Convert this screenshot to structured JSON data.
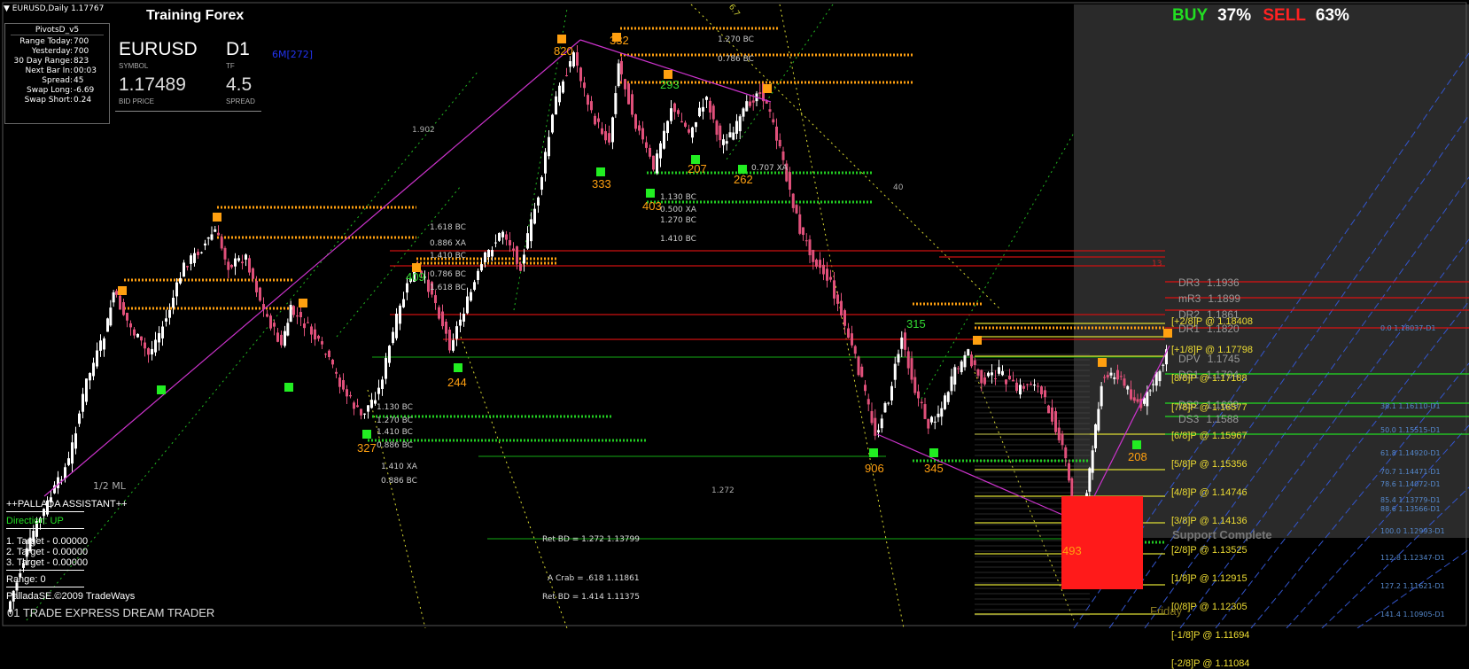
{
  "window": {
    "title": "EURUSD,Daily",
    "price": "1.17767",
    "menu_icon": "triangle-down"
  },
  "header": {
    "training_label": "Training Forex",
    "sixm_label": "6M[272]"
  },
  "pivots": {
    "title": "PivotsD_v5",
    "rows": [
      {
        "label": "Range  Today:",
        "value": "700"
      },
      {
        "label": "Yesterday:",
        "value": "700"
      },
      {
        "label": "30 Day Range:",
        "value": "823"
      },
      {
        "label": "Next Bar In:",
        "value": "00:03"
      },
      {
        "label": "Spread:",
        "value": "45"
      },
      {
        "label": "Swap  Long:",
        "value": "-6.69"
      },
      {
        "label": "Swap  Short:",
        "value": "0.24"
      }
    ]
  },
  "symbol_box": {
    "symbol": "EURUSD",
    "symbol_caption": "SYMBOL",
    "tf": "D1",
    "tf_caption": "TF",
    "bid": "1.17489",
    "bid_caption": "BID PRICE",
    "spread": "4.5",
    "spread_caption": "SPREAD"
  },
  "sentiment": {
    "buy_label": "BUY",
    "buy_pct": "37%",
    "sell_label": "SELL",
    "sell_pct": "63%",
    "buy_color": "#22dd22",
    "sell_color": "#ff2222"
  },
  "assistant": {
    "title": "++PALLADA ASSISTANT++",
    "direction": "Direction: UP",
    "targets": [
      "1. Target - 0.00000",
      "2. Target - 0.00000",
      "3. Target - 0.00000"
    ],
    "range": "Range: 0",
    "copyright": "PalladaSE.©2009 TradeWays",
    "footer": "01 TRADE EXPRESS DREAM TRADER"
  },
  "chart_labels": {
    "half_ml": "1/2 ML",
    "fib_1902": "1.902",
    "fib_1272": "1.272",
    "fib_40": "40",
    "fib_67": "6.7",
    "ret_bd_1": "Ret BD = 1.272  1.13799",
    "a_crab": "A Crab = .618  1.11861",
    "ret_bd_2": "Ret BD = 1.414  1.11375",
    "support_complete": "Support Complete",
    "friday": "Friday",
    "fib_13": "13"
  },
  "swing_labels": [
    "820",
    "332",
    "333",
    "403",
    "207",
    "293",
    "262",
    "409",
    "244",
    "327",
    "906",
    "345",
    "315",
    "493",
    "208"
  ],
  "bc_labels": [
    "1.618 BC",
    "0.886 XA",
    "1.410 BC",
    "0.786 BC",
    "1.130 BC",
    "1.270 BC",
    "1.410 BC",
    "0.886 BC",
    "1.130 BC",
    "0.500 XA",
    "1.270 BC",
    "1.410 BC",
    "1.410 XA",
    "0.886 BC",
    "1.618 BC",
    "1.270 BC",
    "0.786 BC",
    "0.707 XA"
  ],
  "pivot_levels": [
    {
      "name": "DR3",
      "value": "1.1936"
    },
    {
      "name": "mR3",
      "value": "1.1899"
    },
    {
      "name": "DR2",
      "value": "1.1861"
    },
    {
      "name": "DR1",
      "value": "1.1820"
    },
    {
      "name": "DPV",
      "value": "1.1745"
    },
    {
      "name": "DS1",
      "value": "1.1704"
    },
    {
      "name": "DS2",
      "value": "1.1629"
    },
    {
      "name": "DS3",
      "value": "1.1588"
    }
  ],
  "murrey_levels": [
    "[+2/8]P @ 1.18408",
    "[+1/8]P @ 1.17798",
    "[8/8]P @ 1.17188",
    "[7/8]P @ 1.16577",
    "[6/8]P @ 1.15967",
    "[5/8]P @ 1.15356",
    "[4/8]P @ 1.14746",
    "[3/8]P @ 1.14136",
    "[2/8]P @ 1.13525",
    "[1/8]P @ 1.12915",
    "[0/8]P @ 1.12305",
    "[-1/8]P @ 1.11694",
    "[-2/8]P @ 1.11084"
  ],
  "fib_right": [
    "0.0  1.18037-D1",
    "38.1  1.16110-D1",
    "50.0  1.15515-D1",
    "61.8  1.14920-D1",
    "70.7  1.14471-D1",
    "78.6  1.14072-D1",
    "85.4  1.13779-D1",
    "88.6  1.13566-D1",
    "100.0  1.12993-D1",
    "112.8  1.12347-D1",
    "127.2  1.11621-D1",
    "141.4  1.10905-D1"
  ],
  "colors": {
    "bull": "#ffffff",
    "bear": "#e0507a",
    "orange": "#ffa010",
    "green": "#22c022",
    "red": "#cc1111",
    "yellow": "#eedd33"
  }
}
